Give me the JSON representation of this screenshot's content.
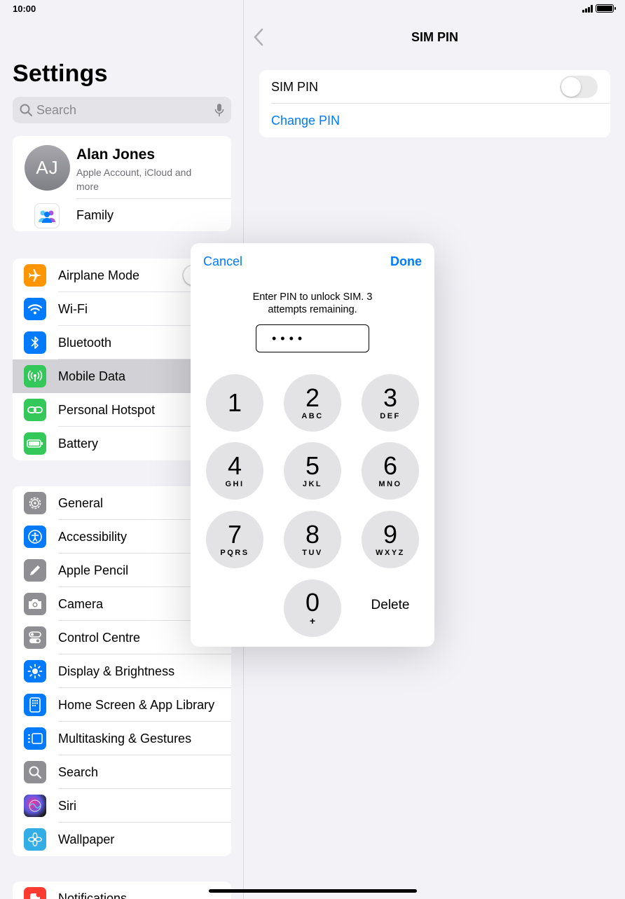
{
  "status": {
    "time": "10:00"
  },
  "sidebar": {
    "title": "Settings",
    "search_placeholder": "Search",
    "profile": {
      "initials": "AJ",
      "name": "Alan Jones",
      "subtitle": "Apple Account, iCloud and more"
    },
    "family_label": "Family",
    "group1": [
      {
        "label": "Airplane Mode",
        "icon": "airplane-icon",
        "color": "#ff9500"
      },
      {
        "label": "Wi-Fi",
        "icon": "wifi-icon",
        "color": "#007aff"
      },
      {
        "label": "Bluetooth",
        "icon": "bluetooth-icon",
        "color": "#007aff"
      },
      {
        "label": "Mobile Data",
        "icon": "antenna-icon",
        "color": "#34c759"
      },
      {
        "label": "Personal Hotspot",
        "icon": "hotspot-icon",
        "color": "#34c759"
      },
      {
        "label": "Battery",
        "icon": "battery-icon",
        "color": "#34c759"
      }
    ],
    "group2": [
      {
        "label": "General",
        "icon": "gear-icon",
        "color": "#8e8e93"
      },
      {
        "label": "Accessibility",
        "icon": "accessibility-icon",
        "color": "#007aff"
      },
      {
        "label": "Apple Pencil",
        "icon": "pencil-icon",
        "color": "#8e8e93"
      },
      {
        "label": "Camera",
        "icon": "camera-icon",
        "color": "#8e8e93"
      },
      {
        "label": "Control Centre",
        "icon": "switches-icon",
        "color": "#8e8e93"
      },
      {
        "label": "Display & Brightness",
        "icon": "sun-icon",
        "color": "#007aff"
      },
      {
        "label": "Home Screen & App Library",
        "icon": "homescreen-icon",
        "color": "#007aff"
      },
      {
        "label": "Multitasking & Gestures",
        "icon": "multitasking-icon",
        "color": "#007aff"
      },
      {
        "label": "Search",
        "icon": "search-icon",
        "color": "#8e8e93"
      },
      {
        "label": "Siri",
        "icon": "siri-icon",
        "color": "#1c1c1e"
      },
      {
        "label": "Wallpaper",
        "icon": "flower-icon",
        "color": "#32ade6"
      }
    ],
    "group3": [
      {
        "label": "Notifications",
        "icon": "bell-icon",
        "color": "#ff3b30"
      }
    ]
  },
  "detail": {
    "title": "SIM PIN",
    "sim_pin_label": "SIM PIN",
    "sim_pin_enabled": false,
    "change_pin_label": "Change PIN"
  },
  "pin_dialog": {
    "cancel_label": "Cancel",
    "done_label": "Done",
    "message": "Enter PIN to unlock SIM. 3 attempts remaining.",
    "entered_value": "••••",
    "delete_label": "Delete",
    "keys": [
      {
        "digit": "1",
        "letters": ""
      },
      {
        "digit": "2",
        "letters": "ABC"
      },
      {
        "digit": "3",
        "letters": "DEF"
      },
      {
        "digit": "4",
        "letters": "GHI"
      },
      {
        "digit": "5",
        "letters": "JKL"
      },
      {
        "digit": "6",
        "letters": "MNO"
      },
      {
        "digit": "7",
        "letters": "PQRS"
      },
      {
        "digit": "8",
        "letters": "TUV"
      },
      {
        "digit": "9",
        "letters": "WXYZ"
      },
      {
        "digit": "0",
        "letters": "+"
      }
    ]
  }
}
